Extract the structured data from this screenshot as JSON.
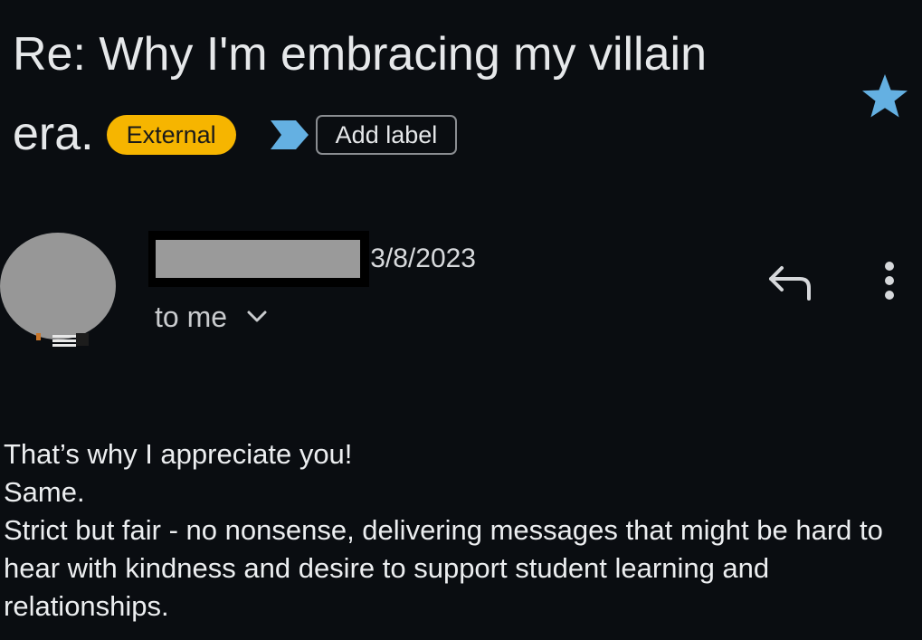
{
  "email": {
    "subject_line1": "Re: Why I'm embracing my villain",
    "subject_line2": "era.",
    "external_badge": "External",
    "add_label": "Add label",
    "date": "3/8/2023",
    "recipient": "to me",
    "body": [
      "That’s why I appreciate you!",
      "Same.",
      "Strict but fair - no nonsense, delivering messages that might be hard to hear with kindness and desire to support student learning and relationships."
    ]
  },
  "icons": {
    "label_arrow": "label-tag-icon",
    "star": "star-icon",
    "reply": "reply-icon",
    "more": "more-vertical-icon",
    "chevron": "chevron-down-icon"
  },
  "colors": {
    "background": "#0a0d11",
    "text": "#e6e8ea",
    "badge_external": "#f6b500",
    "accent_blue": "#64b0e2",
    "redaction": "#9a9a9a"
  }
}
